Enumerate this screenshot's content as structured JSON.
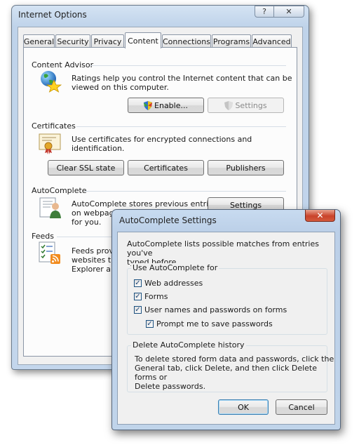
{
  "main_window": {
    "title": "Internet Options",
    "help_glyph": "?",
    "close_glyph": "✕",
    "tabs": [
      "General",
      "Security",
      "Privacy",
      "Content",
      "Connections",
      "Programs",
      "Advanced"
    ],
    "active_tab": "Content",
    "content_advisor": {
      "title": "Content Advisor",
      "description_line1": "Ratings help you control the Internet content that can be",
      "description_line2": "viewed on this computer.",
      "enable_label": "Enable...",
      "settings_label": "Settings"
    },
    "certificates": {
      "title": "Certificates",
      "description": "Use certificates for encrypted connections and identification.",
      "clear_ssl_label": "Clear SSL state",
      "certificates_label": "Certificates",
      "publishers_label": "Publishers"
    },
    "autocomplete": {
      "title": "AutoComplete",
      "description_line1": "AutoComplete stores previous entries",
      "description_line2": "on webpages and suggests matches",
      "description_line3": "for you.",
      "settings_label": "Settings"
    },
    "feeds": {
      "title": "Feeds",
      "description_line1": "Feeds provid",
      "description_line2": "websites tha",
      "description_line3": "Explorer and"
    }
  },
  "dialog": {
    "title": "AutoComplete Settings",
    "close_glyph": "✕",
    "intro_line1": "AutoComplete lists possible matches from entries you've",
    "intro_line2": "typed before.",
    "use_for_group": "Use AutoComplete for",
    "options": {
      "web_addresses": {
        "label": "Web addresses",
        "checked": true
      },
      "forms": {
        "label": "Forms",
        "checked": true
      },
      "usernames": {
        "label": "User names and passwords on forms",
        "checked": true
      },
      "prompt": {
        "label": "Prompt me to save passwords",
        "checked": true
      }
    },
    "check_glyph": "✓",
    "history_group": "Delete AutoComplete history",
    "history_line1": "To delete stored form data and passwords, click the",
    "history_line2": "General tab, click Delete, and then click Delete forms or",
    "history_line3": "Delete passwords.",
    "ok_label": "OK",
    "cancel_label": "Cancel"
  }
}
